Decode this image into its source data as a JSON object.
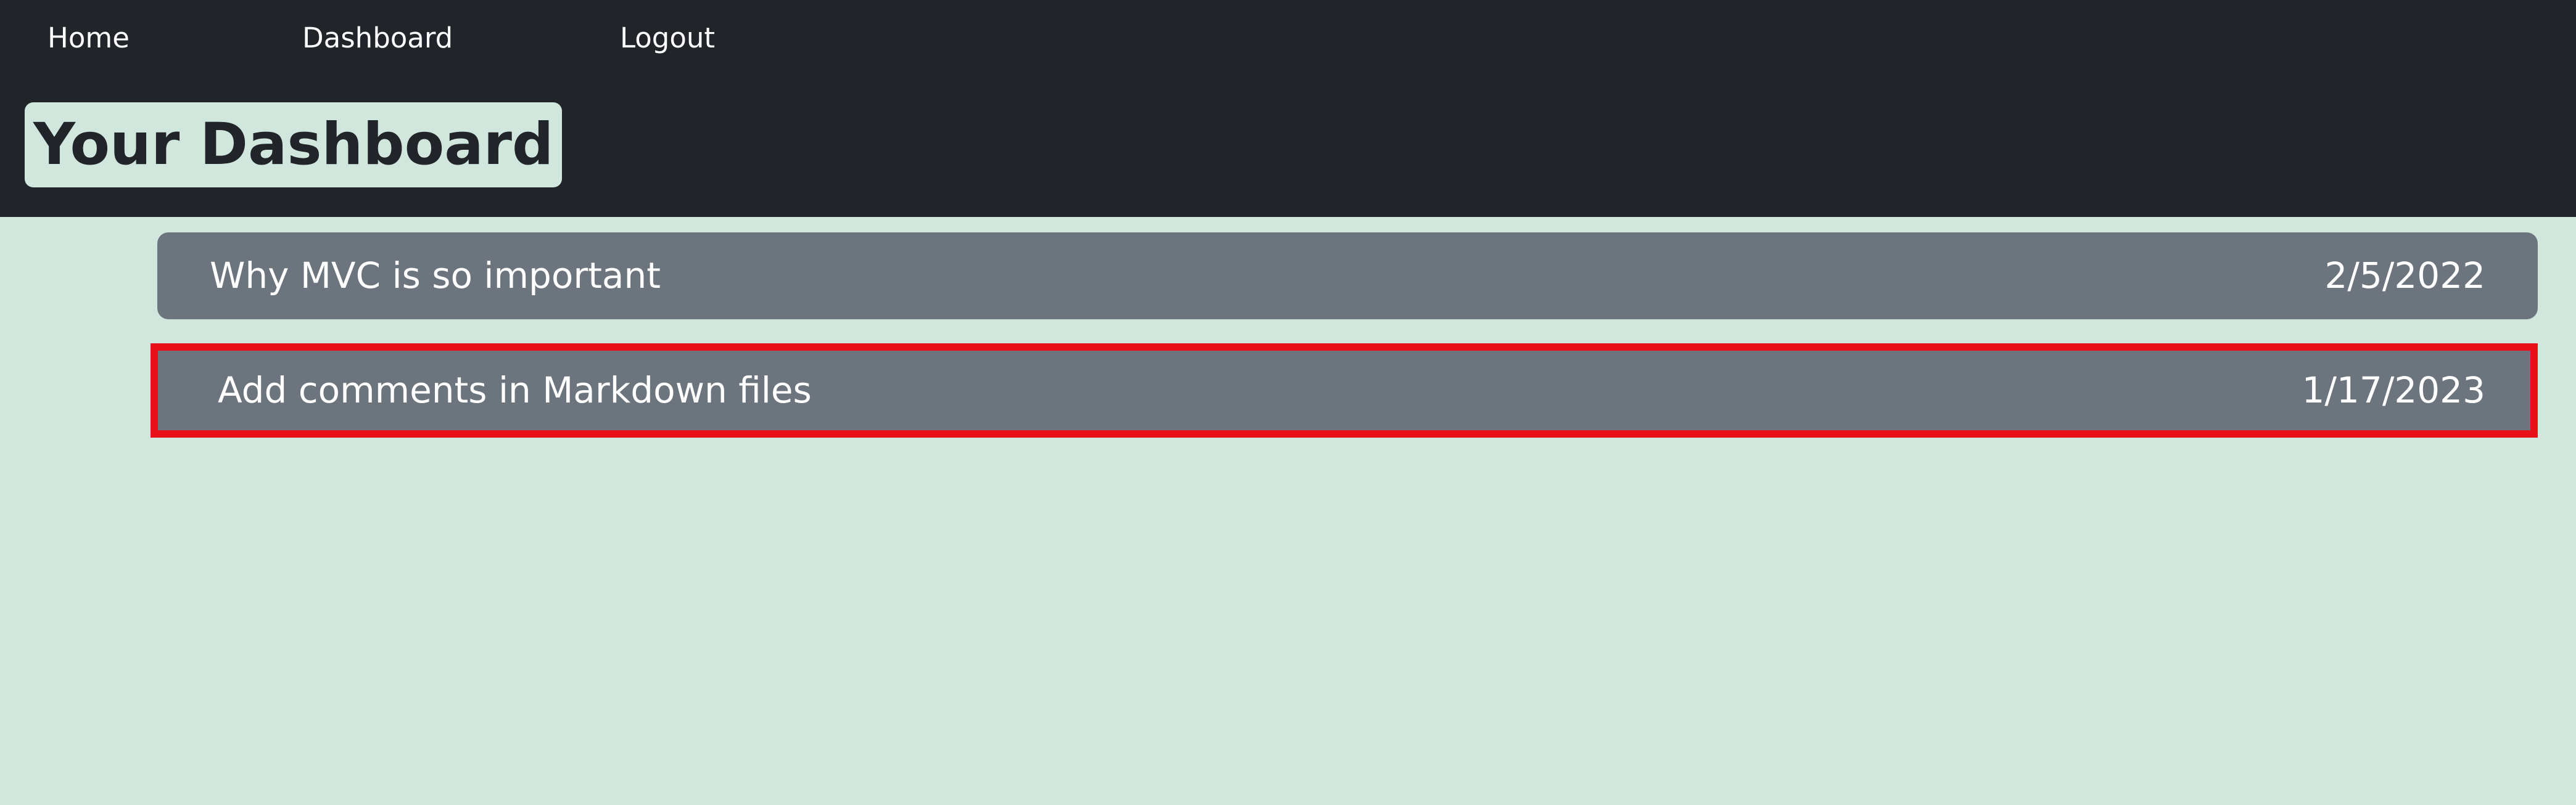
{
  "nav": {
    "home": "Home",
    "dashboard": "Dashboard",
    "logout": "Logout"
  },
  "header": {
    "title": "Your Dashboard"
  },
  "posts": [
    {
      "title": "Why MVC is so important",
      "date": "2/5/2022"
    },
    {
      "title": "Add comments in Markdown files",
      "date": "1/17/2023"
    }
  ],
  "colors": {
    "header_bg": "#212529",
    "page_bg": "#d1e7dd",
    "row_bg": "#6c757d",
    "highlight_border": "#e8101a"
  }
}
